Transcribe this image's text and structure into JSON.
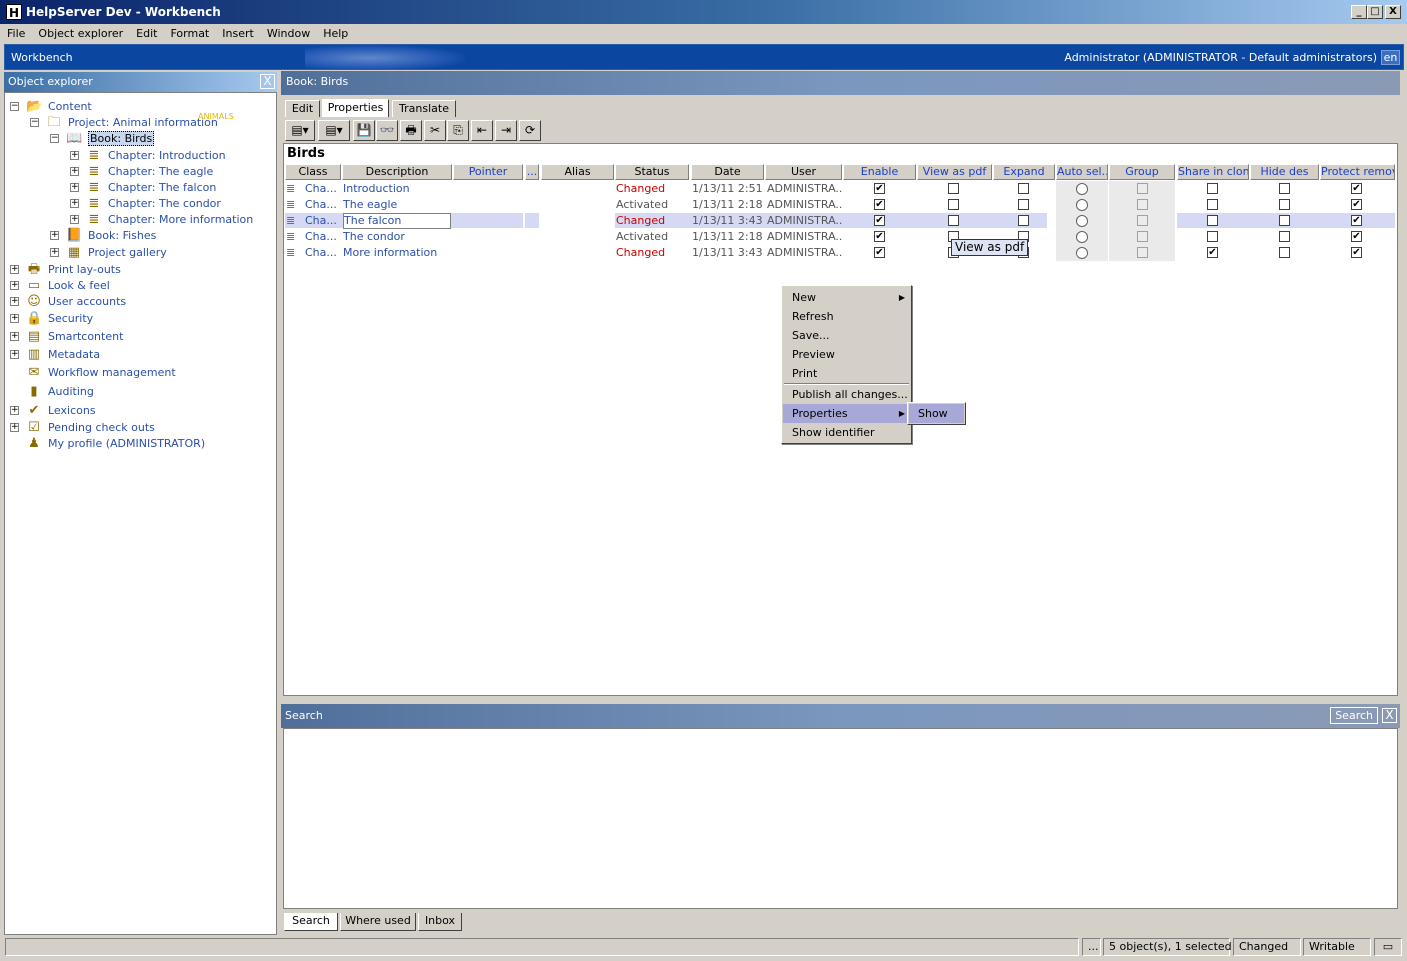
{
  "window": {
    "title": "HelpServer Dev - Workbench",
    "app_icon": "H",
    "controls": [
      "_",
      "□",
      "X"
    ]
  },
  "menu": [
    "File",
    "Object explorer",
    "Edit",
    "Format",
    "Insert",
    "Window",
    "Help"
  ],
  "workbench": {
    "label": "Workbench",
    "user": "Administrator (ADMINISTRATOR - Default administrators)",
    "language": "en"
  },
  "explorer": {
    "title": "Object explorer",
    "close": "X",
    "badge": "ANIMALS",
    "items": [
      {
        "label": "Content",
        "icon": "folder-icon",
        "exp": "−"
      },
      {
        "label": "Project: Animal information",
        "icon": "project-folder-icon",
        "exp": "−"
      },
      {
        "label": "Book: Birds",
        "icon": "open-book-icon",
        "exp": "−"
      },
      {
        "label": "Chapter: Introduction",
        "icon": "chapter-icon",
        "exp": "+"
      },
      {
        "label": "Chapter: The eagle",
        "icon": "chapter-icon",
        "exp": "+"
      },
      {
        "label": "Chapter: The falcon",
        "icon": "chapter-icon",
        "exp": "+"
      },
      {
        "label": "Chapter: The condor",
        "icon": "chapter-icon",
        "exp": "+"
      },
      {
        "label": "Chapter: More information",
        "icon": "chapter-icon",
        "exp": "+"
      },
      {
        "label": "Book: Fishes",
        "icon": "book-icon",
        "exp": "+"
      },
      {
        "label": "Project gallery",
        "icon": "gallery-icon",
        "exp": "+"
      },
      {
        "label": "Print lay-outs",
        "icon": "printer-icon",
        "exp": "+"
      },
      {
        "label": "Look & feel",
        "icon": "monitor-icon",
        "exp": "+"
      },
      {
        "label": "User accounts",
        "icon": "users-icon",
        "exp": "+"
      },
      {
        "label": "Security",
        "icon": "lock-icon",
        "exp": "+"
      },
      {
        "label": "Smartcontent",
        "icon": "smartcontent-icon",
        "exp": "+"
      },
      {
        "label": "Metadata",
        "icon": "metadata-icon",
        "exp": "+"
      },
      {
        "label": "Workflow management",
        "icon": "workflow-icon",
        "exp": ""
      },
      {
        "label": "Auditing",
        "icon": "chart-icon",
        "exp": ""
      },
      {
        "label": "Lexicons",
        "icon": "spellcheck-icon",
        "exp": "+"
      },
      {
        "label": "Pending check outs",
        "icon": "checkout-icon",
        "exp": "+"
      },
      {
        "label": "My profile (ADMINISTRATOR)",
        "icon": "profile-icon",
        "exp": ""
      }
    ]
  },
  "book": {
    "header": "Book: Birds",
    "tabs": [
      "Edit",
      "Properties",
      "Translate"
    ],
    "grid_title": "Birds",
    "toolbar_glyphs": [
      "▤▾",
      "▤▾",
      "💾",
      "👓",
      "🖶",
      "✂",
      "⎘",
      "⇤",
      "⇥",
      "⟳"
    ],
    "columns": [
      "Class",
      "Description",
      "Pointer",
      "...",
      "Alias",
      "Status",
      "Date",
      "User",
      "Enable",
      "View as pdf",
      "Expand",
      "Auto sel...",
      "Group",
      "Share in clone",
      "Hide des",
      "Protect remov..."
    ],
    "rows": [
      {
        "class": "Cha...",
        "description": "Introduction",
        "status": "Changed",
        "date": "1/13/11 2:51...",
        "user": "ADMINISTRA...",
        "enable": true,
        "pdf": false,
        "expand": false,
        "share": false,
        "hide": false,
        "protect": true
      },
      {
        "class": "Cha...",
        "description": "The eagle",
        "status": "Activated",
        "date": "1/13/11 2:18...",
        "user": "ADMINISTRA...",
        "enable": true,
        "pdf": false,
        "expand": false,
        "share": false,
        "hide": false,
        "protect": true
      },
      {
        "class": "Cha...",
        "description": "The falcon",
        "status": "Changed",
        "date": "1/13/11 3:43...",
        "user": "ADMINISTRA...",
        "enable": true,
        "pdf": false,
        "expand": false,
        "share": false,
        "hide": false,
        "protect": true
      },
      {
        "class": "Cha...",
        "description": "The condor",
        "status": "Activated",
        "date": "1/13/11 2:18...",
        "user": "ADMINISTRA...",
        "enable": true,
        "pdf": false,
        "expand": false,
        "share": false,
        "hide": false,
        "protect": true
      },
      {
        "class": "Cha...",
        "description": "More information",
        "status": "Changed",
        "date": "1/13/11 3:43...",
        "user": "ADMINISTRA...",
        "enable": true,
        "pdf": false,
        "expand": false,
        "share": true,
        "hide": false,
        "protect": true
      }
    ],
    "tooltip": "View as pdf",
    "check_mark": "✔"
  },
  "context_menu": {
    "items": [
      "New",
      "Refresh",
      "Save...",
      "Preview",
      "Print",
      "Publish all changes...",
      "Properties",
      "Show identifier"
    ],
    "submenu": "Show"
  },
  "search": {
    "title": "Search",
    "button": "Search",
    "close": "X",
    "bottom_tabs": [
      "Search",
      "Where used",
      "Inbox"
    ]
  },
  "status": {
    "dots": "...",
    "selection": "5 object(s), 1 selected",
    "state": "Changed",
    "mode": "Writable"
  },
  "colors": {
    "link_blue": "#2a4fa8",
    "changed_red": "#cc0000",
    "selection": "#d6d9f4",
    "menu_highlight": "#a8a8d8"
  }
}
